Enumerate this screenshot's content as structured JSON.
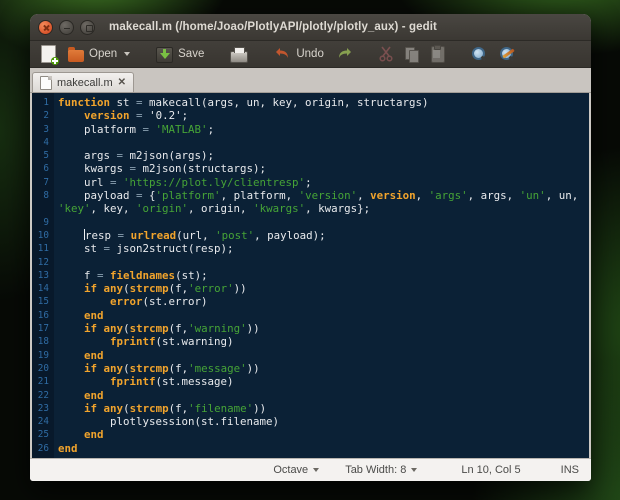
{
  "window": {
    "title": "makecall.m (/home/Joao/PlotlyAPI/plotly/plotly_aux) - gedit"
  },
  "toolbar": {
    "open_label": "Open",
    "save_label": "Save",
    "undo_label": "Undo"
  },
  "tabbar": {
    "tab_label": "makecall.m",
    "close_glyph": "✕"
  },
  "statusbar": {
    "language": "Octave",
    "tab_width": "Tab Width: 8",
    "position": "Ln 10, Col 5",
    "mode": "INS"
  },
  "colors": {
    "editor_background": "#0b2136",
    "keyword": "#f2a42c",
    "string": "#46a437",
    "line_number": "#2f6ba3",
    "titlebar": "#3b3833",
    "wallpaper_green": "#3f8c28"
  },
  "editor": {
    "rows": [
      {
        "n": "1",
        "t": [
          [
            "kw",
            "function"
          ],
          [
            "tx",
            " st "
          ],
          [
            "op",
            "="
          ],
          [
            "tx",
            " makecall(args, un, key, origin, structargs)"
          ]
        ]
      },
      {
        "n": "2",
        "t": [
          [
            "tx",
            "    "
          ],
          [
            "kw",
            "version"
          ],
          [
            "tx",
            " "
          ],
          [
            "op",
            "="
          ],
          [
            "tx",
            " '0.2';"
          ]
        ]
      },
      {
        "n": "3",
        "t": [
          [
            "tx",
            "    platform "
          ],
          [
            "op",
            "="
          ],
          [
            "tx",
            " "
          ],
          [
            "str",
            "'MATLAB'"
          ],
          [
            "tx",
            ";"
          ]
        ]
      },
      {
        "n": "4",
        "t": []
      },
      {
        "n": "5",
        "t": [
          [
            "tx",
            "    args "
          ],
          [
            "op",
            "="
          ],
          [
            "tx",
            " m2json(args);"
          ]
        ]
      },
      {
        "n": "6",
        "t": [
          [
            "tx",
            "    kwargs "
          ],
          [
            "op",
            "="
          ],
          [
            "tx",
            " m2json(structargs);"
          ]
        ]
      },
      {
        "n": "7",
        "t": [
          [
            "tx",
            "    url "
          ],
          [
            "op",
            "="
          ],
          [
            "tx",
            " "
          ],
          [
            "str",
            "'https://plot.ly/clientresp'"
          ],
          [
            "tx",
            ";"
          ]
        ]
      },
      {
        "n": "8",
        "t": [
          [
            "tx",
            "    payload "
          ],
          [
            "op",
            "="
          ],
          [
            "tx",
            " {"
          ],
          [
            "str",
            "'platform'"
          ],
          [
            "tx",
            ", platform, "
          ],
          [
            "str",
            "'version'"
          ],
          [
            "tx",
            ", "
          ],
          [
            "kw",
            "version"
          ],
          [
            "tx",
            ", "
          ],
          [
            "str",
            "'args'"
          ],
          [
            "tx",
            ", args, "
          ],
          [
            "str",
            "'un'"
          ],
          [
            "tx",
            ", un,"
          ]
        ]
      },
      {
        "n": "",
        "t": [
          [
            "str",
            "'key'"
          ],
          [
            "tx",
            ", key, "
          ],
          [
            "str",
            "'origin'"
          ],
          [
            "tx",
            ", origin, "
          ],
          [
            "str",
            "'kwargs'"
          ],
          [
            "tx",
            ", kwargs};"
          ]
        ]
      },
      {
        "n": "9",
        "t": []
      },
      {
        "n": "10",
        "t": [
          [
            "tx",
            "    "
          ],
          [
            "cur",
            ""
          ],
          [
            "tx",
            "resp "
          ],
          [
            "op",
            "="
          ],
          [
            "tx",
            " "
          ],
          [
            "kw",
            "urlread"
          ],
          [
            "tx",
            "(url, "
          ],
          [
            "str",
            "'post'"
          ],
          [
            "tx",
            ", payload);"
          ]
        ]
      },
      {
        "n": "11",
        "t": [
          [
            "tx",
            "    st "
          ],
          [
            "op",
            "="
          ],
          [
            "tx",
            " json2struct(resp);"
          ]
        ]
      },
      {
        "n": "12",
        "t": []
      },
      {
        "n": "13",
        "t": [
          [
            "tx",
            "    f "
          ],
          [
            "op",
            "="
          ],
          [
            "tx",
            " "
          ],
          [
            "kw",
            "fieldnames"
          ],
          [
            "tx",
            "(st);"
          ]
        ]
      },
      {
        "n": "14",
        "t": [
          [
            "tx",
            "    "
          ],
          [
            "kw",
            "if"
          ],
          [
            "tx",
            " "
          ],
          [
            "kw",
            "any"
          ],
          [
            "tx",
            "("
          ],
          [
            "kw",
            "strcmp"
          ],
          [
            "tx",
            "(f,"
          ],
          [
            "str",
            "'error'"
          ],
          [
            "tx",
            "))"
          ]
        ]
      },
      {
        "n": "15",
        "t": [
          [
            "tx",
            "        "
          ],
          [
            "kw",
            "error"
          ],
          [
            "tx",
            "(st.error)"
          ]
        ]
      },
      {
        "n": "16",
        "t": [
          [
            "tx",
            "    "
          ],
          [
            "kw",
            "end"
          ]
        ]
      },
      {
        "n": "17",
        "t": [
          [
            "tx",
            "    "
          ],
          [
            "kw",
            "if"
          ],
          [
            "tx",
            " "
          ],
          [
            "kw",
            "any"
          ],
          [
            "tx",
            "("
          ],
          [
            "kw",
            "strcmp"
          ],
          [
            "tx",
            "(f,"
          ],
          [
            "str",
            "'warning'"
          ],
          [
            "tx",
            "))"
          ]
        ]
      },
      {
        "n": "18",
        "t": [
          [
            "tx",
            "        "
          ],
          [
            "kw",
            "fprintf"
          ],
          [
            "tx",
            "(st.warning)"
          ]
        ]
      },
      {
        "n": "19",
        "t": [
          [
            "tx",
            "    "
          ],
          [
            "kw",
            "end"
          ]
        ]
      },
      {
        "n": "20",
        "t": [
          [
            "tx",
            "    "
          ],
          [
            "kw",
            "if"
          ],
          [
            "tx",
            " "
          ],
          [
            "kw",
            "any"
          ],
          [
            "tx",
            "("
          ],
          [
            "kw",
            "strcmp"
          ],
          [
            "tx",
            "(f,"
          ],
          [
            "str",
            "'message'"
          ],
          [
            "tx",
            "))"
          ]
        ]
      },
      {
        "n": "21",
        "t": [
          [
            "tx",
            "        "
          ],
          [
            "kw",
            "fprintf"
          ],
          [
            "tx",
            "(st.message)"
          ]
        ]
      },
      {
        "n": "22",
        "t": [
          [
            "tx",
            "    "
          ],
          [
            "kw",
            "end"
          ]
        ]
      },
      {
        "n": "23",
        "t": [
          [
            "tx",
            "    "
          ],
          [
            "kw",
            "if"
          ],
          [
            "tx",
            " "
          ],
          [
            "kw",
            "any"
          ],
          [
            "tx",
            "("
          ],
          [
            "kw",
            "strcmp"
          ],
          [
            "tx",
            "(f,"
          ],
          [
            "str",
            "'filename'"
          ],
          [
            "tx",
            "))"
          ]
        ]
      },
      {
        "n": "24",
        "t": [
          [
            "tx",
            "        plotlysession(st.filename)"
          ]
        ]
      },
      {
        "n": "25",
        "t": [
          [
            "tx",
            "    "
          ],
          [
            "kw",
            "end"
          ]
        ]
      },
      {
        "n": "26",
        "t": [
          [
            "kw",
            "end"
          ]
        ]
      }
    ]
  }
}
